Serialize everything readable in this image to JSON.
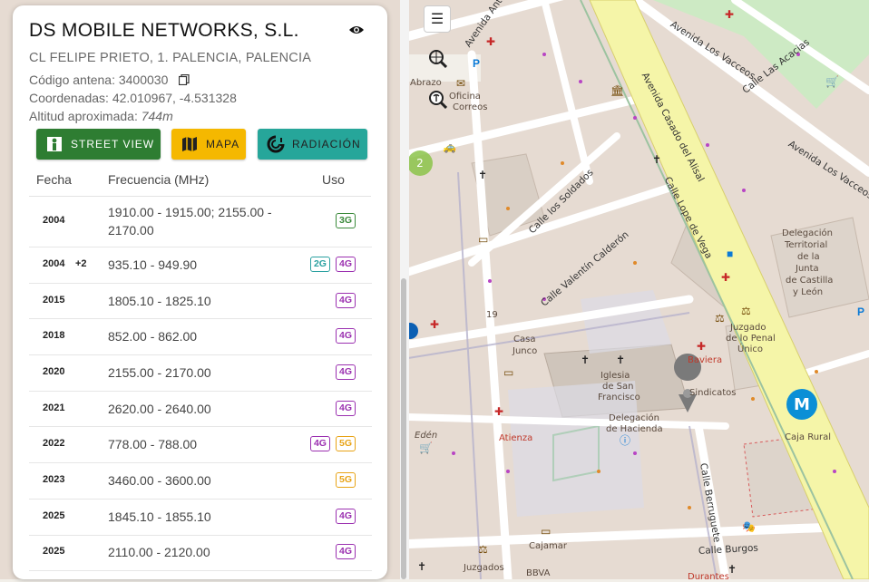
{
  "operator": {
    "name": "DS MOBILE NETWORKS, S.L.",
    "address": "CL FELIPE PRIETO, 1. PALENCIA, PALENCIA",
    "antenna_label": "Código antena:",
    "antenna_code": "3400030",
    "coords_label": "Coordenadas:",
    "coords": "42.010967, -4.531328",
    "altitude_label": "Altitud aproximada:",
    "altitude": "744m"
  },
  "actions": {
    "street_view": "STREET VIEW",
    "map": "MAPA",
    "radiation": "RADIACIÓN"
  },
  "colors": {
    "street_view_btn": "#2e7d32",
    "map_btn": "#f5b800",
    "radiation_btn": "#26a69a"
  },
  "table": {
    "headers": {
      "date": "Fecha",
      "frequency": "Frecuencia (MHz)",
      "use": "Uso"
    },
    "rows": [
      {
        "year": "2004",
        "extra": "",
        "freq": "1910.00 - 1915.00; 2155.00 - 2170.00",
        "badges": [
          "3G"
        ]
      },
      {
        "year": "2004",
        "extra": "+2",
        "freq": "935.10 - 949.90",
        "badges": [
          "2G",
          "4G"
        ]
      },
      {
        "year": "2015",
        "extra": "",
        "freq": "1805.10 - 1825.10",
        "badges": [
          "4G"
        ]
      },
      {
        "year": "2018",
        "extra": "",
        "freq": "852.00 - 862.00",
        "badges": [
          "4G"
        ]
      },
      {
        "year": "2020",
        "extra": "",
        "freq": "2155.00 - 2170.00",
        "badges": [
          "4G"
        ]
      },
      {
        "year": "2021",
        "extra": "",
        "freq": "2620.00 - 2640.00",
        "badges": [
          "4G"
        ]
      },
      {
        "year": "2022",
        "extra": "",
        "freq": "778.00 - 788.00",
        "badges": [
          "4G",
          "5G"
        ]
      },
      {
        "year": "2023",
        "extra": "",
        "freq": "3460.00 - 3600.00",
        "badges": [
          "5G"
        ]
      },
      {
        "year": "2025",
        "extra": "",
        "freq": "1845.10 - 1855.10",
        "badges": [
          "4G"
        ]
      },
      {
        "year": "2025",
        "extra": "",
        "freq": "2110.00 - 2120.00",
        "badges": [
          "4G"
        ]
      }
    ]
  },
  "map": {
    "cluster_count": "2",
    "menu_icon": "hamburger-icon",
    "streets": [
      "Avenida Antigua",
      "Avenida Los Vacceos",
      "Calle Las Acacias",
      "Avenida Casado del Alisal",
      "Calle los Soldados",
      "Calle Lope de Vega",
      "Calle Valentín Calderón",
      "Calle Berruguete",
      "Calle Burgos",
      "Avenida Los Vacceos"
    ],
    "places": [
      "Abrazo",
      "Oficina",
      "Correos",
      "Delegación",
      "Territorial",
      "de la",
      "Junta",
      "de Castilla",
      "y León",
      "Casa",
      "Junco",
      "19",
      "Juzgado",
      "de lo Penal",
      "Único",
      "Baviera",
      "Iglesia",
      "de San",
      "Francisco",
      "Sindicatos",
      "Delegación",
      "de Hacienda",
      "Caja Rural",
      "Atienza",
      "Edén",
      "Cajamar",
      "Juzgados",
      "BBVA",
      "Durantes"
    ]
  }
}
